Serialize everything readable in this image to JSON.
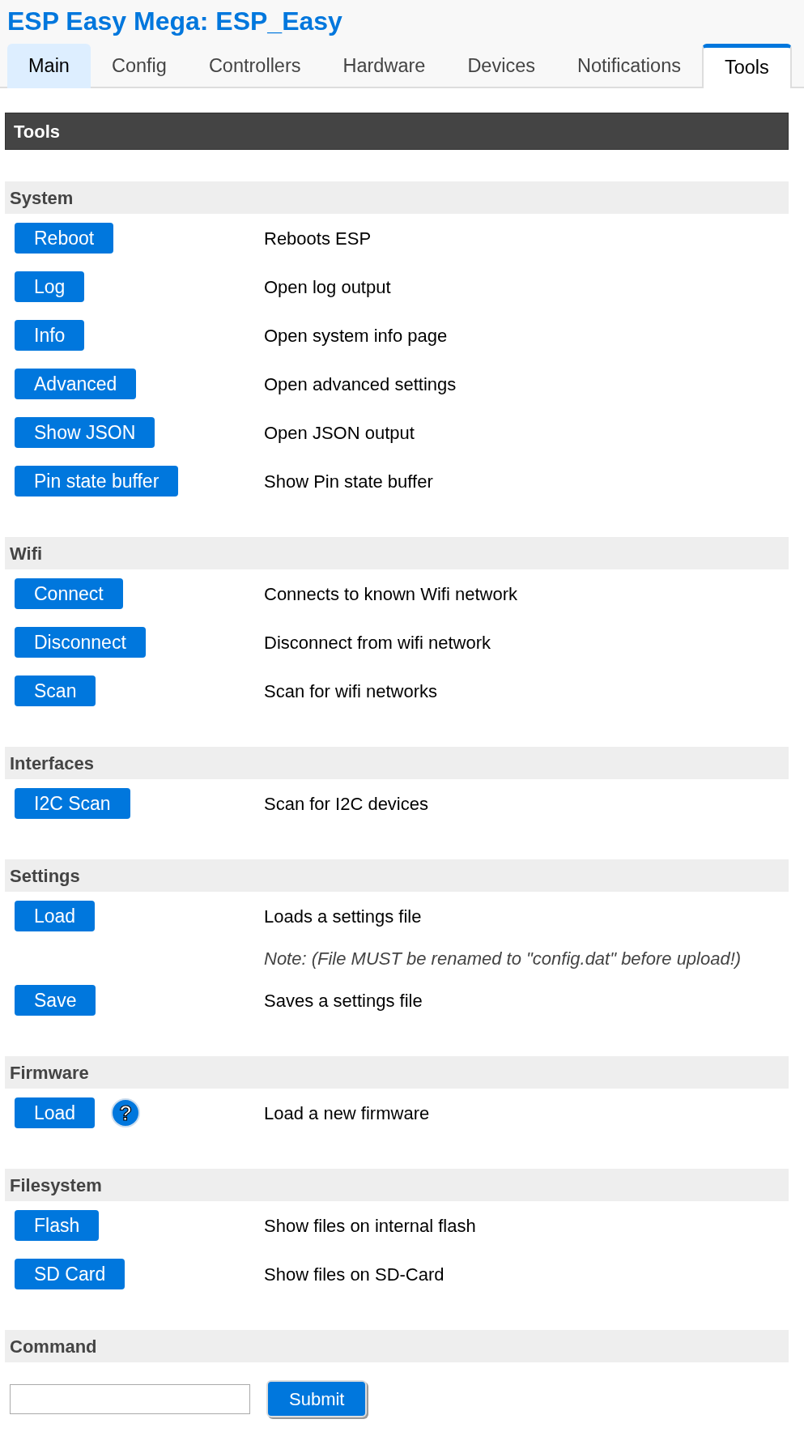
{
  "header": {
    "title": "ESP Easy Mega: ESP_Easy"
  },
  "tabs": [
    {
      "label": "Main",
      "selected": false,
      "hovered": true
    },
    {
      "label": "Config",
      "selected": false,
      "hovered": false
    },
    {
      "label": "Controllers",
      "selected": false,
      "hovered": false
    },
    {
      "label": "Hardware",
      "selected": false,
      "hovered": false
    },
    {
      "label": "Devices",
      "selected": false,
      "hovered": false
    },
    {
      "label": "Notifications",
      "selected": false,
      "hovered": false
    },
    {
      "label": "Tools",
      "selected": true,
      "hovered": false
    }
  ],
  "page_title": "Tools",
  "sections": [
    {
      "heading": "System",
      "rows": [
        {
          "kind": "button",
          "button": "Reboot",
          "description": "Reboots ESP"
        },
        {
          "kind": "button",
          "button": "Log",
          "description": "Open log output"
        },
        {
          "kind": "button",
          "button": "Info",
          "description": "Open system info page"
        },
        {
          "kind": "button",
          "button": "Advanced",
          "description": "Open advanced settings"
        },
        {
          "kind": "button",
          "button": "Show JSON",
          "description": "Open JSON output"
        },
        {
          "kind": "button",
          "button": "Pin state buffer",
          "description": "Show Pin state buffer"
        }
      ]
    },
    {
      "heading": "Wifi",
      "rows": [
        {
          "kind": "button",
          "button": "Connect",
          "description": "Connects to known Wifi network"
        },
        {
          "kind": "button",
          "button": "Disconnect",
          "description": "Disconnect from wifi network"
        },
        {
          "kind": "button",
          "button": "Scan",
          "description": "Scan for wifi networks"
        }
      ]
    },
    {
      "heading": "Interfaces",
      "rows": [
        {
          "kind": "button",
          "button": "I2C Scan",
          "description": "Scan for I2C devices"
        }
      ]
    },
    {
      "heading": "Settings",
      "rows": [
        {
          "kind": "button",
          "button": "Load",
          "description": "Loads a settings file"
        },
        {
          "kind": "note",
          "description": "Note: (File MUST be renamed to \"config.dat\" before upload!)"
        },
        {
          "kind": "button",
          "button": "Save",
          "description": "Saves a settings file"
        }
      ]
    },
    {
      "heading": "Firmware",
      "rows": [
        {
          "kind": "button",
          "button": "Load",
          "help": "?",
          "description": "Load a new firmware"
        }
      ]
    },
    {
      "heading": "Filesystem",
      "rows": [
        {
          "kind": "button",
          "button": "Flash",
          "description": "Show files on internal flash"
        },
        {
          "kind": "button",
          "button": "SD Card",
          "description": "Show files on SD-Card"
        }
      ]
    },
    {
      "heading": "Command",
      "rows": [
        {
          "kind": "command",
          "submit": "Submit"
        }
      ]
    }
  ]
}
